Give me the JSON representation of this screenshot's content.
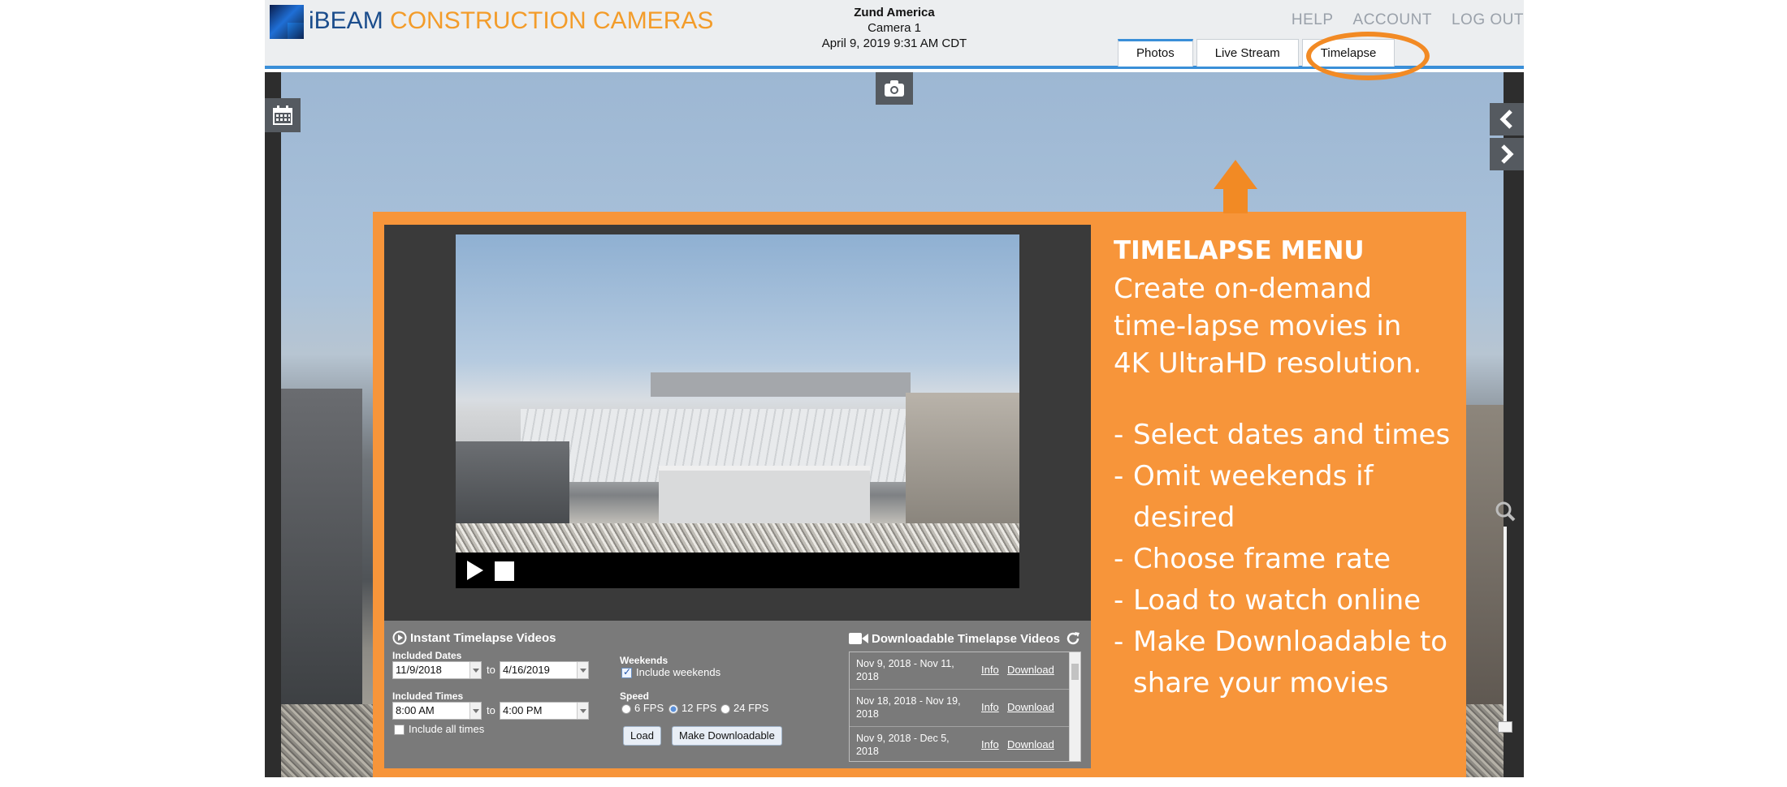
{
  "header": {
    "brand_ibeam": "iBEAM",
    "brand_rest": "CONSTRUCTION CAMERAS",
    "site_name": "Zund America",
    "camera": "Camera 1",
    "timestamp": "April 9, 2019 9:31 AM CDT",
    "nav": {
      "help": "HELP",
      "account": "ACCOUNT",
      "logout": "LOG OUT"
    },
    "tabs": {
      "photos": "Photos",
      "live_stream": "Live Stream",
      "timelapse": "Timelapse"
    },
    "colors": {
      "brand_orange": "#f39c2a",
      "brand_blue": "#1b4d8c",
      "accent_blue": "#3a8fd8"
    }
  },
  "viewer": {
    "icons": {
      "calendar": "calendar-icon",
      "camera": "camera-icon",
      "film": "film-icon",
      "prev": "chevron-left-icon",
      "next": "chevron-right-icon",
      "zoom": "magnifier-icon"
    }
  },
  "callout": {
    "heading": "TIMELAPSE MENU",
    "lines": [
      "Create on-demand",
      "time-lapse movies in",
      "4K UltraHD resolution."
    ],
    "bullets": [
      {
        "text": "Select dates and times"
      },
      {
        "text": "Omit weekends if desired"
      },
      {
        "text": "Choose frame rate"
      },
      {
        "text": "Load to watch online"
      },
      {
        "text": "Make Downloadable to",
        "cont": "share your movies"
      }
    ],
    "color": "#f7953a"
  },
  "timelapse": {
    "instant_title": "Instant Timelapse Videos",
    "included_dates_label": "Included Dates",
    "date_from": "11/9/2018",
    "date_to": "4/16/2019",
    "to_label": "to",
    "included_times_label": "Included Times",
    "time_from": "8:00 AM",
    "time_to": "4:00 PM",
    "include_all_times": "Include all times",
    "weekends_label": "Weekends",
    "include_weekends": "Include weekends",
    "speed_label": "Speed",
    "speeds": [
      "6 FPS",
      "12 FPS",
      "24 FPS"
    ],
    "selected_speed": "12 FPS",
    "load_button": "Load",
    "make_downloadable_button": "Make Downloadable",
    "downloadable_title": "Downloadable Timelapse Videos",
    "downloads": [
      {
        "range": "Nov 9, 2018 - Nov 11, 2018",
        "info": "Info",
        "download": "Download"
      },
      {
        "range": "Nov 18, 2018 - Nov 19, 2018",
        "info": "Info",
        "download": "Download"
      },
      {
        "range": "Nov 9, 2018 - Dec 5, 2018",
        "info": "Info",
        "download": "Download"
      }
    ]
  }
}
